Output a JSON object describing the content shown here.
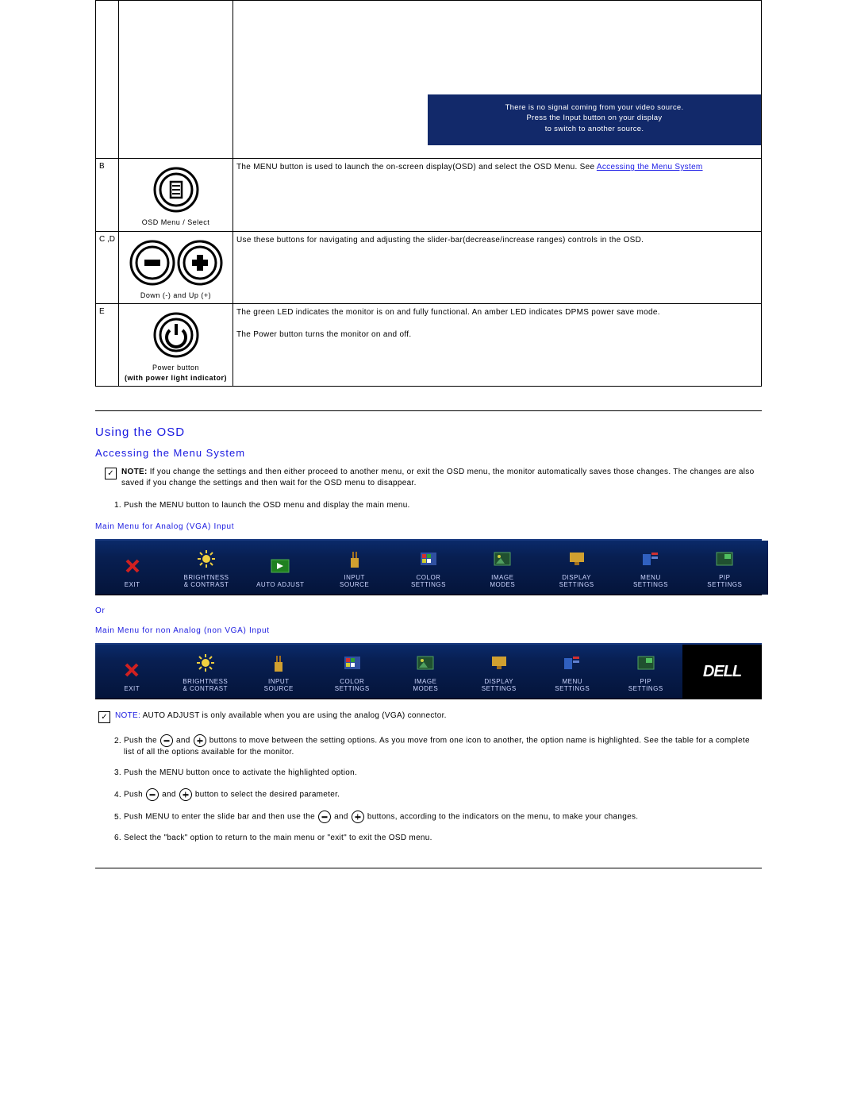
{
  "no_signal": {
    "line1": "There is no signal coming from your video source.",
    "line2": "Press the Input button on your display",
    "line3": "to switch to another source."
  },
  "table_rows": {
    "b": {
      "label": "B",
      "caption": "OSD Menu /  Select",
      "desc_prefix": "The MENU button is used to launch the on-screen display(OSD) and select the OSD Menu. See ",
      "link_text": "Accessing the Menu System"
    },
    "cd": {
      "label": "C ,D",
      "caption": "Down (-) and Up (+)",
      "desc": "Use these buttons for navigating and adjusting the slider-bar(decrease/increase ranges) controls in the OSD."
    },
    "e": {
      "label": "E",
      "caption_line1": "Power button",
      "caption_line2": "(with power light indicator)",
      "desc_line1": "The green LED indicates the monitor is on and fully functional. An amber LED indicates DPMS power save mode.",
      "desc_line2": "The Power button turns the monitor on and off."
    }
  },
  "headings": {
    "using_osd": "Using the OSD",
    "accessing": "Accessing the Menu System"
  },
  "note1": {
    "label": "NOTE:",
    "text": " If you change the settings and then either proceed to another menu, or exit the OSD menu, the monitor automatically saves those changes. The changes are also saved if you change the settings and then wait for the OSD menu to disappear."
  },
  "note2": {
    "label": "NOTE:",
    "text": " AUTO ADJUST is only available when you are using the analog (VGA) connector."
  },
  "steps": {
    "s1": "Push the MENU button to launch the OSD menu and display the main menu.",
    "s2_a": "Push the ",
    "s2_b": " and ",
    "s2_c": " buttons to move between the setting options. As you move from one icon to another, the option name is highlighted. See the table for a complete list of all the options available for the monitor.",
    "s3": "Push the MENU button once to activate the highlighted option.",
    "s4_a": "Push ",
    "s4_b": " and ",
    "s4_c": " button to select the desired parameter.",
    "s5_a": "Push MENU to enter the slide bar and then use the ",
    "s5_b": " and ",
    "s5_c": " buttons, according to the indicators on the menu, to make your changes.",
    "s6": "Select the \"back\" option to return to the main menu or \"exit\" to exit the OSD menu."
  },
  "menu_labels": {
    "analog": "Main Menu for Analog (VGA) Input",
    "or": "Or",
    "non_analog": "Main Menu for non Analog (non VGA) Input"
  },
  "osd_items": {
    "exit": "EXIT",
    "brightness_l1": "BRIGHTNESS",
    "brightness_l2": "& CONTRAST",
    "auto_adjust": "AUTO ADJUST",
    "input_l1": "INPUT",
    "input_l2": "SOURCE",
    "color_l1": "COLOR",
    "color_l2": "SETTINGS",
    "image_l1": "IMAGE",
    "image_l2": "MODES",
    "display_l1": "DISPLAY",
    "display_l2": "SETTINGS",
    "menu_l1": "MENU",
    "menu_l2": "SETTINGS",
    "pip_l1": "PIP",
    "pip_l2": "SETTINGS"
  },
  "dell": "DELL"
}
